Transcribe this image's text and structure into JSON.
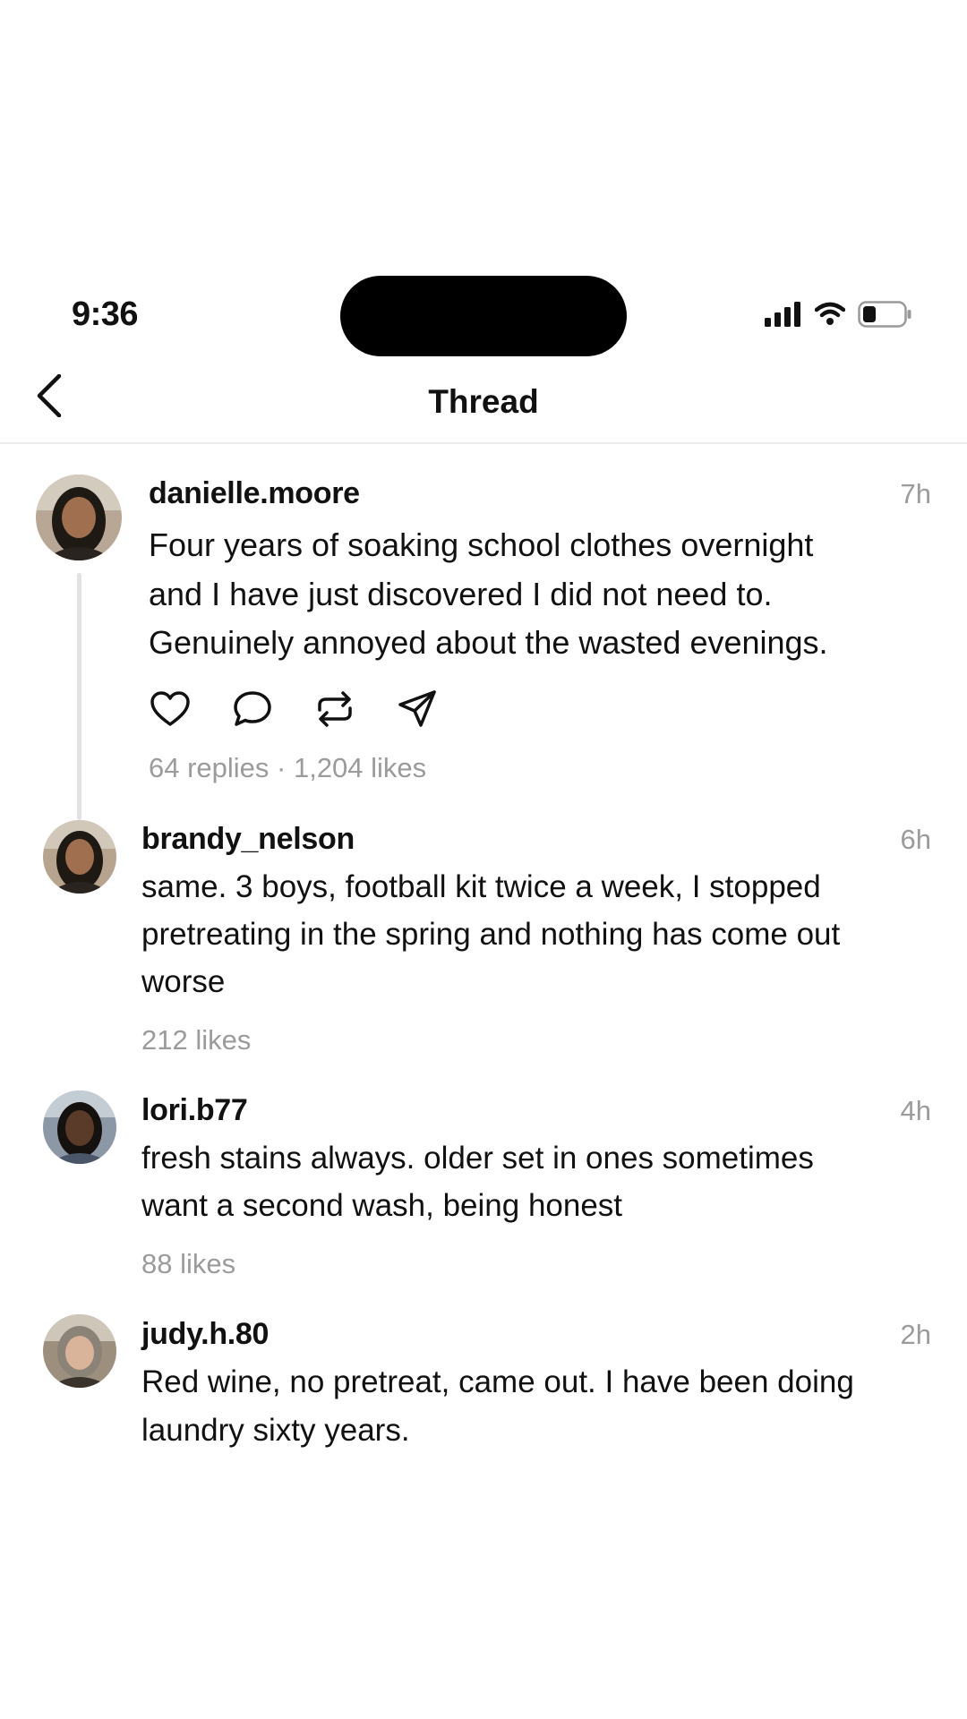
{
  "status_bar": {
    "time": "9:36"
  },
  "nav": {
    "title": "Thread",
    "back_icon": "chevron-left-icon"
  },
  "main_post": {
    "username": "danielle.moore",
    "time": "7h",
    "lines": [
      "Four years of soaking school clothes overnight",
      "and I have just discovered I did not need to.",
      "Genuinely annoyed about the wasted evenings."
    ],
    "actions": [
      "heart-icon",
      "comment-icon",
      "repost-icon",
      "send-icon"
    ],
    "stats": "64 replies · 1,204 likes"
  },
  "replies": [
    {
      "username": "brandy_nelson",
      "time": "6h",
      "lines": [
        "same. 3 boys, football kit twice a week, I stopped",
        "pretreating in the spring and nothing has come out",
        "worse"
      ],
      "likes": "212 likes"
    },
    {
      "username": "lori.b77",
      "time": "4h",
      "lines": [
        "fresh stains always. older set in ones sometimes",
        "want a second wash, being honest"
      ],
      "likes": "88 likes"
    },
    {
      "username": "judy.h.80",
      "time": "2h",
      "lines": [
        "Red wine, no pretreat, came out. I have been doing",
        "laundry sixty years."
      ]
    }
  ]
}
